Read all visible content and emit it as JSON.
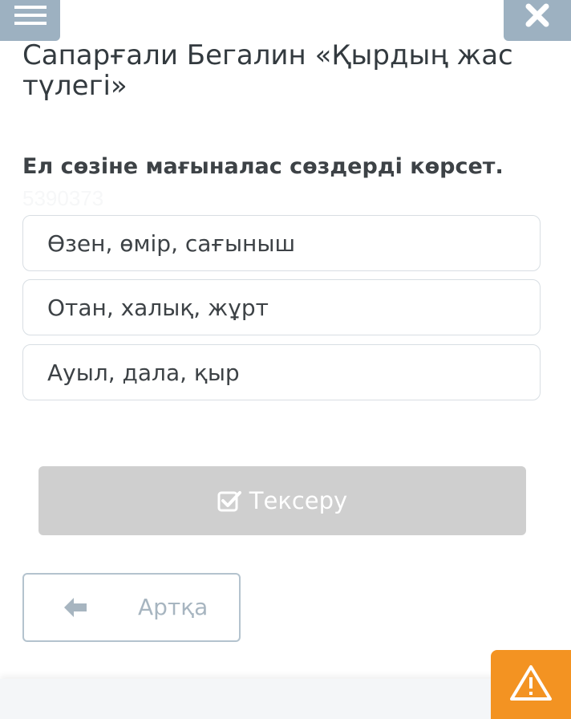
{
  "header": {
    "menu_icon": "hamburger-menu-icon",
    "close_icon": "close-x-icon",
    "title": "Сапарғали Бегалин «Қырдың жас түлегі»"
  },
  "question": {
    "text": "Ел сөзіне мағыналас сөздерді көрсет.",
    "id": "5390373"
  },
  "options": [
    {
      "label": "Өзен, өмір, сағыныш"
    },
    {
      "label": "Отан, халық, жұрт"
    },
    {
      "label": "Ауыл, дала, қыр"
    }
  ],
  "check_button": {
    "label": "Тексеру",
    "icon": "checkbox-check-icon",
    "state": "disabled"
  },
  "back_button": {
    "label": "Артқа",
    "icon": "arrow-left-icon"
  },
  "alert_button": {
    "icon": "warning-triangle-icon"
  },
  "colors": {
    "header_buttons": "#9db1c1",
    "check_button_disabled": "#cfcfcf",
    "alert": "#f39322",
    "text": "#3d4246",
    "option_border": "#d8dee3"
  }
}
